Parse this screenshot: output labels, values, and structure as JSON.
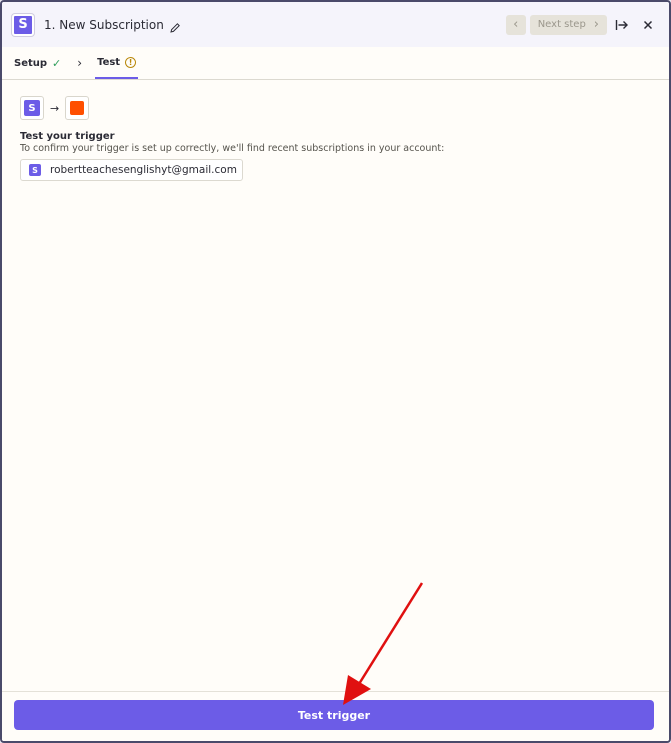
{
  "header": {
    "app_logo_letter": "S",
    "title": "1. New Subscription",
    "prev_icon": "chevron-left-icon",
    "next_label": "Next step",
    "next_icon": "chevron-right-icon",
    "expand_icon": "expand-right-icon",
    "close_icon": "close-icon"
  },
  "tabs": [
    {
      "label": "Setup",
      "status_icon": "check-icon",
      "active": false
    },
    {
      "label": "Test",
      "status_icon": "warning-icon",
      "active": true
    }
  ],
  "content": {
    "source_logo_letter": "S",
    "heading": "Test your trigger",
    "description": "To confirm your trigger is set up correctly, we'll find recent subscriptions in your account:",
    "account_logo_letter": "S",
    "account_email": "robertteachesenglishyt@gmail.com"
  },
  "footer": {
    "button_label": "Test trigger"
  },
  "colors": {
    "accent": "#6c5ce7",
    "trigger_orange": "#ff4f00",
    "annotation_red": "#e01010"
  }
}
